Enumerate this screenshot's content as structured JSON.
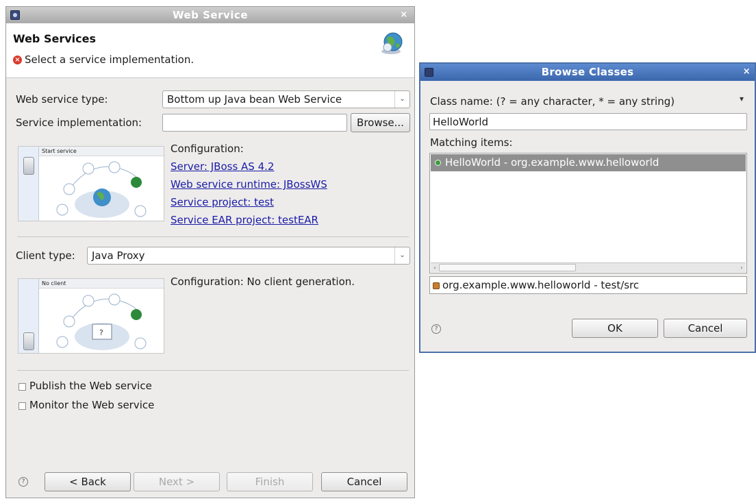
{
  "web_service_window": {
    "title": "Web Service",
    "header_title": "Web Services",
    "header_message": "Select a service implementation.",
    "web_service_type_label": "Web service type:",
    "web_service_type_value": "Bottom up Java bean Web Service",
    "service_impl_label": "Service implementation:",
    "service_impl_value": "",
    "browse_label": "Browse...",
    "service_art_caption": "Start service",
    "service_config_heading": "Configuration:",
    "service_links": {
      "server": "Server: JBoss AS 4.2",
      "runtime": "Web service runtime: JBossWS",
      "project": "Service project: test",
      "ear": "Service EAR project: testEAR"
    },
    "client_type_label": "Client type:",
    "client_type_value": "Java Proxy",
    "client_art_caption": "No client",
    "client_config": "Configuration: No client generation.",
    "publish_label": "Publish the Web service",
    "monitor_label": "Monitor the Web service",
    "buttons": {
      "back": "< Back",
      "next": "Next >",
      "finish": "Finish",
      "cancel": "Cancel"
    }
  },
  "browse_dialog": {
    "title": "Browse Classes",
    "class_name_label": "Class name: (? = any character, * = any string)",
    "class_name_value": "HelloWorld",
    "matching_label": "Matching items:",
    "matching_items": [
      "HelloWorld - org.example.www.helloworld"
    ],
    "qualifier": "org.example.www.helloworld - test/src",
    "ok_label": "OK",
    "cancel_label": "Cancel"
  }
}
